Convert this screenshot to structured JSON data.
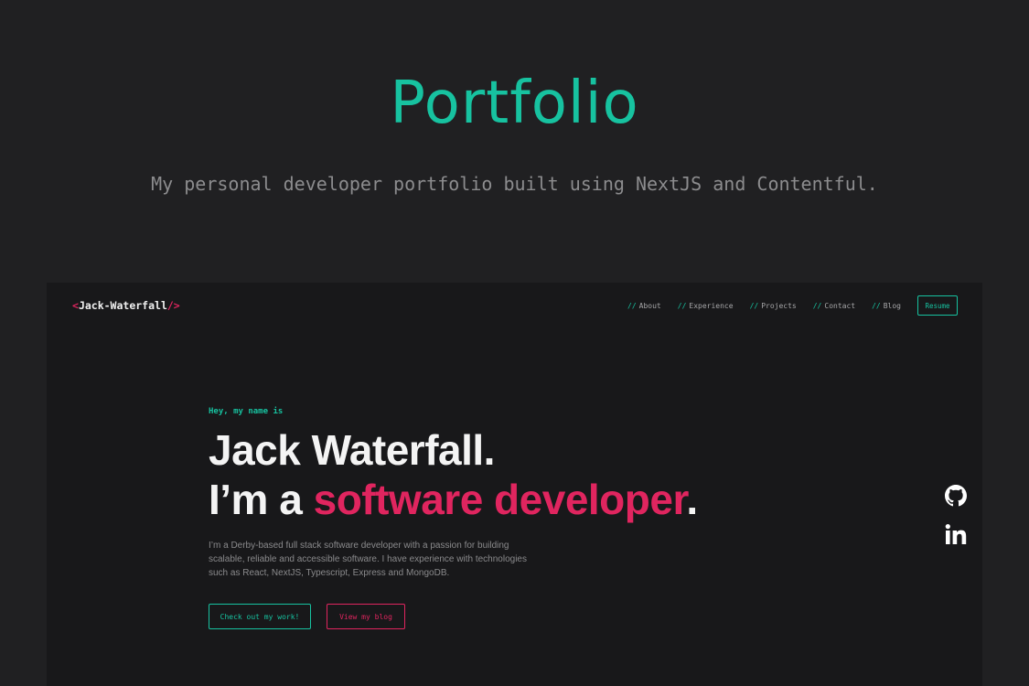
{
  "hero": {
    "title": "Portfolio",
    "subtitle": "My personal developer portfolio built using NextJS and Contentful."
  },
  "site": {
    "logo": {
      "open": "<",
      "name": "Jack-Waterfall",
      "close": "/>"
    },
    "nav": {
      "slash": "//",
      "items": [
        {
          "label": "About"
        },
        {
          "label": "Experience"
        },
        {
          "label": "Projects"
        },
        {
          "label": "Contact"
        },
        {
          "label": "Blog"
        }
      ],
      "resume": "Resume"
    },
    "intro": {
      "greeting": "Hey, my name is",
      "name_line": "Jack Waterfall.",
      "role_prefix": "I’m a ",
      "role": "software developer",
      "role_suffix": ".",
      "bio": "I’m a Derby-based full stack software developer with a passion for building scalable, reliable and accessible software. I have experience with technologies such as React, NextJS, Typescript, Express and MongoDB."
    },
    "buttons": {
      "work": "Check out my work!",
      "blog": "View my blog"
    },
    "social": {
      "icons": [
        "github-icon",
        "linkedin-icon"
      ]
    }
  },
  "colors": {
    "background": "#202022",
    "screenshot_background": "#18181a",
    "accent_teal": "#17c2a0",
    "accent_pink": "#e0255f",
    "text_light": "#f4f4f4",
    "text_muted": "#8a8a8c"
  }
}
